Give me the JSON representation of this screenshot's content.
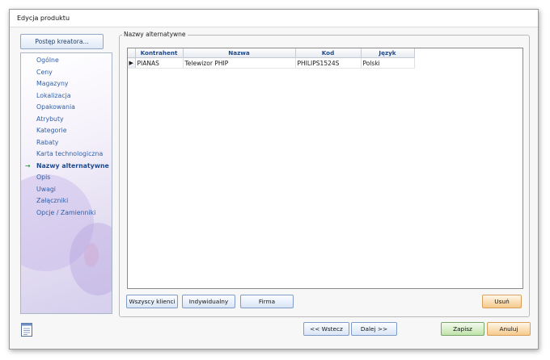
{
  "window": {
    "title": "Edycja produktu"
  },
  "sidebar": {
    "wizard_button": "Postęp kreatora...",
    "items": [
      {
        "label": "Ogólne"
      },
      {
        "label": "Ceny"
      },
      {
        "label": "Magazyny"
      },
      {
        "label": "Lokalizacja"
      },
      {
        "label": "Opakowania"
      },
      {
        "label": "Atrybuty"
      },
      {
        "label": "Kategorie"
      },
      {
        "label": "Rabaty"
      },
      {
        "label": "Karta technologiczna"
      },
      {
        "label": "Nazwy alternatywne",
        "active": true,
        "marker": "→"
      },
      {
        "label": "Opis"
      },
      {
        "label": "Uwagi"
      },
      {
        "label": "Załączniki"
      },
      {
        "label": "Opcje / Zamienniki"
      }
    ]
  },
  "group": {
    "title": "Nazwy alternatywne",
    "grid": {
      "columns": [
        "Kontrahent",
        "Nazwa",
        "Kod",
        "Język"
      ],
      "rows": [
        {
          "selected": true,
          "marker": "▶",
          "cells": [
            "PIANAS",
            "Telewizor PHIP",
            "PHILIPS1524S",
            "Polski"
          ]
        }
      ]
    },
    "buttons": {
      "all_clients": "Wszyscy klienci",
      "individual": "Indywidualny",
      "company": "Firma",
      "delete": "Usuń"
    }
  },
  "footer": {
    "back": "<< Wstecz",
    "next": "Dalej >>",
    "save": "Zapisz",
    "cancel": "Anuluj"
  },
  "icons": [
    "note-icon",
    "row-indicator-icon",
    "current-step-arrow-icon"
  ]
}
